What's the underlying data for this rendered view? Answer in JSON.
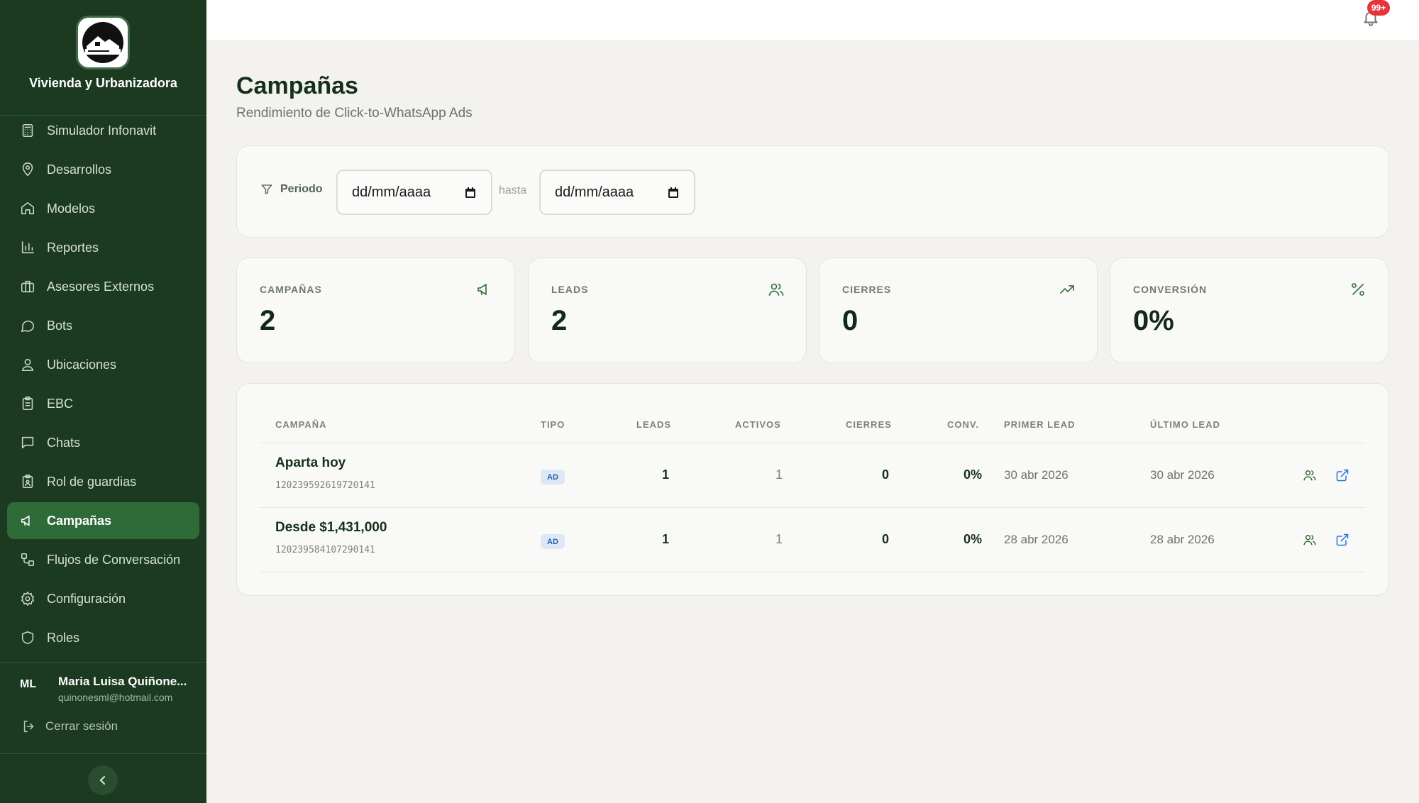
{
  "brand": {
    "name": "Vivienda y Urbanizadora",
    "logo_icon": "house-logo-icon"
  },
  "sidebar": {
    "items": [
      {
        "label": "Simulador Infonavit",
        "icon": "calculator-icon"
      },
      {
        "label": "Desarrollos",
        "icon": "map-pin-icon"
      },
      {
        "label": "Modelos",
        "icon": "home-icon"
      },
      {
        "label": "Reportes",
        "icon": "bar-chart-icon"
      },
      {
        "label": "Asesores Externos",
        "icon": "briefcase-icon"
      },
      {
        "label": "Bots",
        "icon": "message-circle-icon"
      },
      {
        "label": "Ubicaciones",
        "icon": "user-pin-icon"
      },
      {
        "label": "EBC",
        "icon": "clipboard-icon"
      },
      {
        "label": "Chats",
        "icon": "message-square-icon"
      },
      {
        "label": "Rol de guardias",
        "icon": "clipboard-user-icon"
      },
      {
        "label": "Campañas",
        "icon": "megaphone-icon",
        "active": true
      },
      {
        "label": "Flujos de Conversación",
        "icon": "workflow-icon"
      },
      {
        "label": "Configuración",
        "icon": "gear-icon"
      },
      {
        "label": "Roles",
        "icon": "shield-icon"
      }
    ]
  },
  "user": {
    "initials": "ML",
    "name": "Maria Luisa Quiñone...",
    "email": "quinonesml@hotmail.com",
    "logout_label": "Cerrar sesión"
  },
  "topbar": {
    "notification_count": "99+"
  },
  "page": {
    "title": "Campañas",
    "subtitle": "Rendimiento de Click-to-WhatsApp Ads"
  },
  "filters": {
    "label": "Periodo",
    "from_placeholder": "dd/mm/aaaa",
    "separator": "hasta",
    "to_placeholder": "dd/mm/aaaa"
  },
  "stats": [
    {
      "label": "CAMPAÑAS",
      "value": "2",
      "icon": "megaphone-icon"
    },
    {
      "label": "LEADS",
      "value": "2",
      "icon": "users-icon"
    },
    {
      "label": "CIERRES",
      "value": "0",
      "icon": "trending-up-icon"
    },
    {
      "label": "CONVERSIÓN",
      "value": "0%",
      "icon": "percent-icon"
    }
  ],
  "table": {
    "headers": [
      "CAMPAÑA",
      "TIPO",
      "LEADS",
      "ACTIVOS",
      "CIERRES",
      "CONV.",
      "PRIMER LEAD",
      "ÚLTIMO LEAD"
    ],
    "rows": [
      {
        "name": "Aparta hoy",
        "id": "120239592619720141",
        "tipo": "AD",
        "leads": "1",
        "activos": "1",
        "cierres": "0",
        "conv": "0%",
        "primer": "30 abr 2026",
        "ultimo": "30 abr 2026"
      },
      {
        "name": "Desde $1,431,000",
        "id": "120239584107290141",
        "tipo": "AD",
        "leads": "1",
        "activos": "1",
        "cierres": "0",
        "conv": "0%",
        "primer": "28 abr 2026",
        "ultimo": "28 abr 2026"
      }
    ]
  },
  "colors": {
    "sidebar_bg": "#1b3a20",
    "active_bg": "#2f6b38",
    "accent_green": "#3e7a47",
    "link_blue": "#2b6fd6",
    "badge_red": "#e5343a"
  }
}
